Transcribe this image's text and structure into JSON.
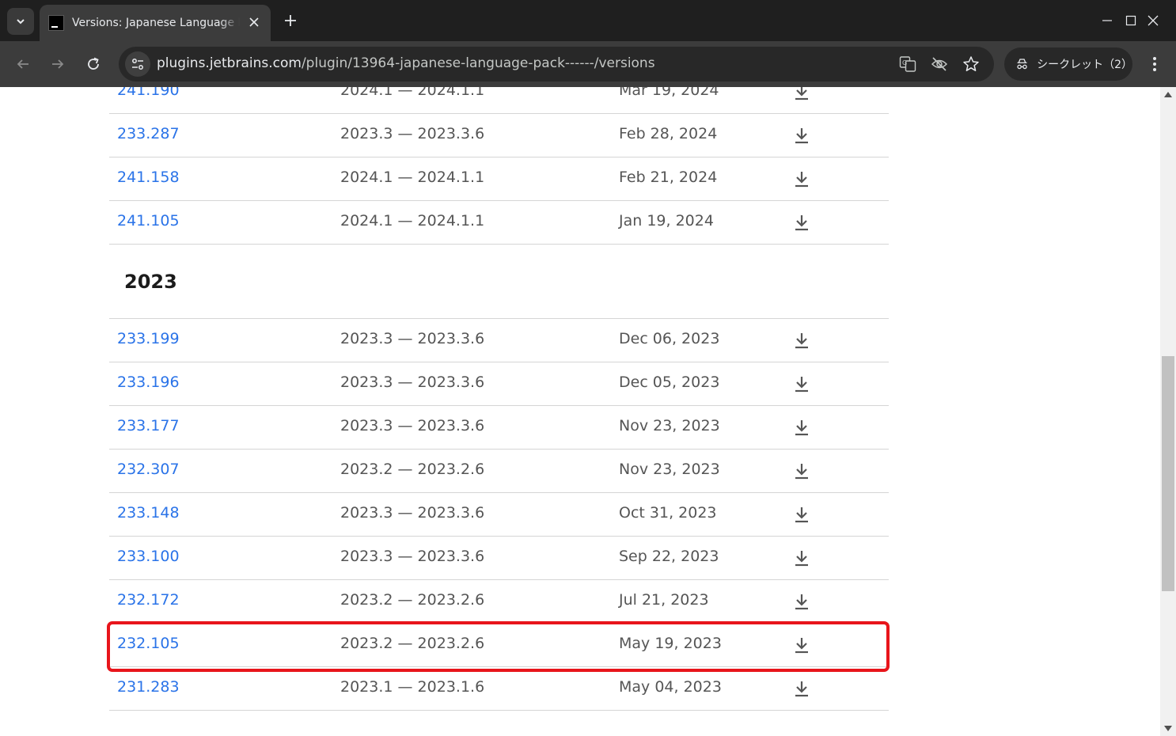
{
  "tab": {
    "title": "Versions: Japanese Language Pack",
    "new_tab": "+"
  },
  "toolbar": {
    "url_host": "plugins.jetbrains.com",
    "url_path": "/plugin/13964-japanese-language-pack------/versions",
    "incognito_label": "シークレット（2）"
  },
  "versions": {
    "rows_before": [
      {
        "version": "241.190",
        "compat": "2024.1 — 2024.1.1",
        "date": "Mar 19, 2024"
      },
      {
        "version": "233.287",
        "compat": "2023.3 — 2023.3.6",
        "date": "Feb 28, 2024"
      },
      {
        "version": "241.158",
        "compat": "2024.1 — 2024.1.1",
        "date": "Feb 21, 2024"
      },
      {
        "version": "241.105",
        "compat": "2024.1 — 2024.1.1",
        "date": "Jan 19, 2024"
      }
    ],
    "year_heading": "2023",
    "rows_after": [
      {
        "version": "233.199",
        "compat": "2023.3 — 2023.3.6",
        "date": "Dec 06, 2023"
      },
      {
        "version": "233.196",
        "compat": "2023.3 — 2023.3.6",
        "date": "Dec 05, 2023"
      },
      {
        "version": "233.177",
        "compat": "2023.3 — 2023.3.6",
        "date": "Nov 23, 2023"
      },
      {
        "version": "232.307",
        "compat": "2023.2 — 2023.2.6",
        "date": "Nov 23, 2023"
      },
      {
        "version": "233.148",
        "compat": "2023.3 — 2023.3.6",
        "date": "Oct 31, 2023"
      },
      {
        "version": "233.100",
        "compat": "2023.3 — 2023.3.6",
        "date": "Sep 22, 2023"
      },
      {
        "version": "232.172",
        "compat": "2023.2 — 2023.2.6",
        "date": "Jul 21, 2023"
      },
      {
        "version": "232.105",
        "compat": "2023.2 — 2023.2.6",
        "date": "May 19, 2023"
      },
      {
        "version": "231.283",
        "compat": "2023.1 — 2023.1.6",
        "date": "May 04, 2023"
      }
    ]
  },
  "icons": {
    "download": "download-icon",
    "back": "back-arrow-icon",
    "forward": "forward-arrow-icon",
    "reload": "reload-icon"
  },
  "colors": {
    "link": "#2a73e8",
    "highlight": "#e8151b"
  }
}
